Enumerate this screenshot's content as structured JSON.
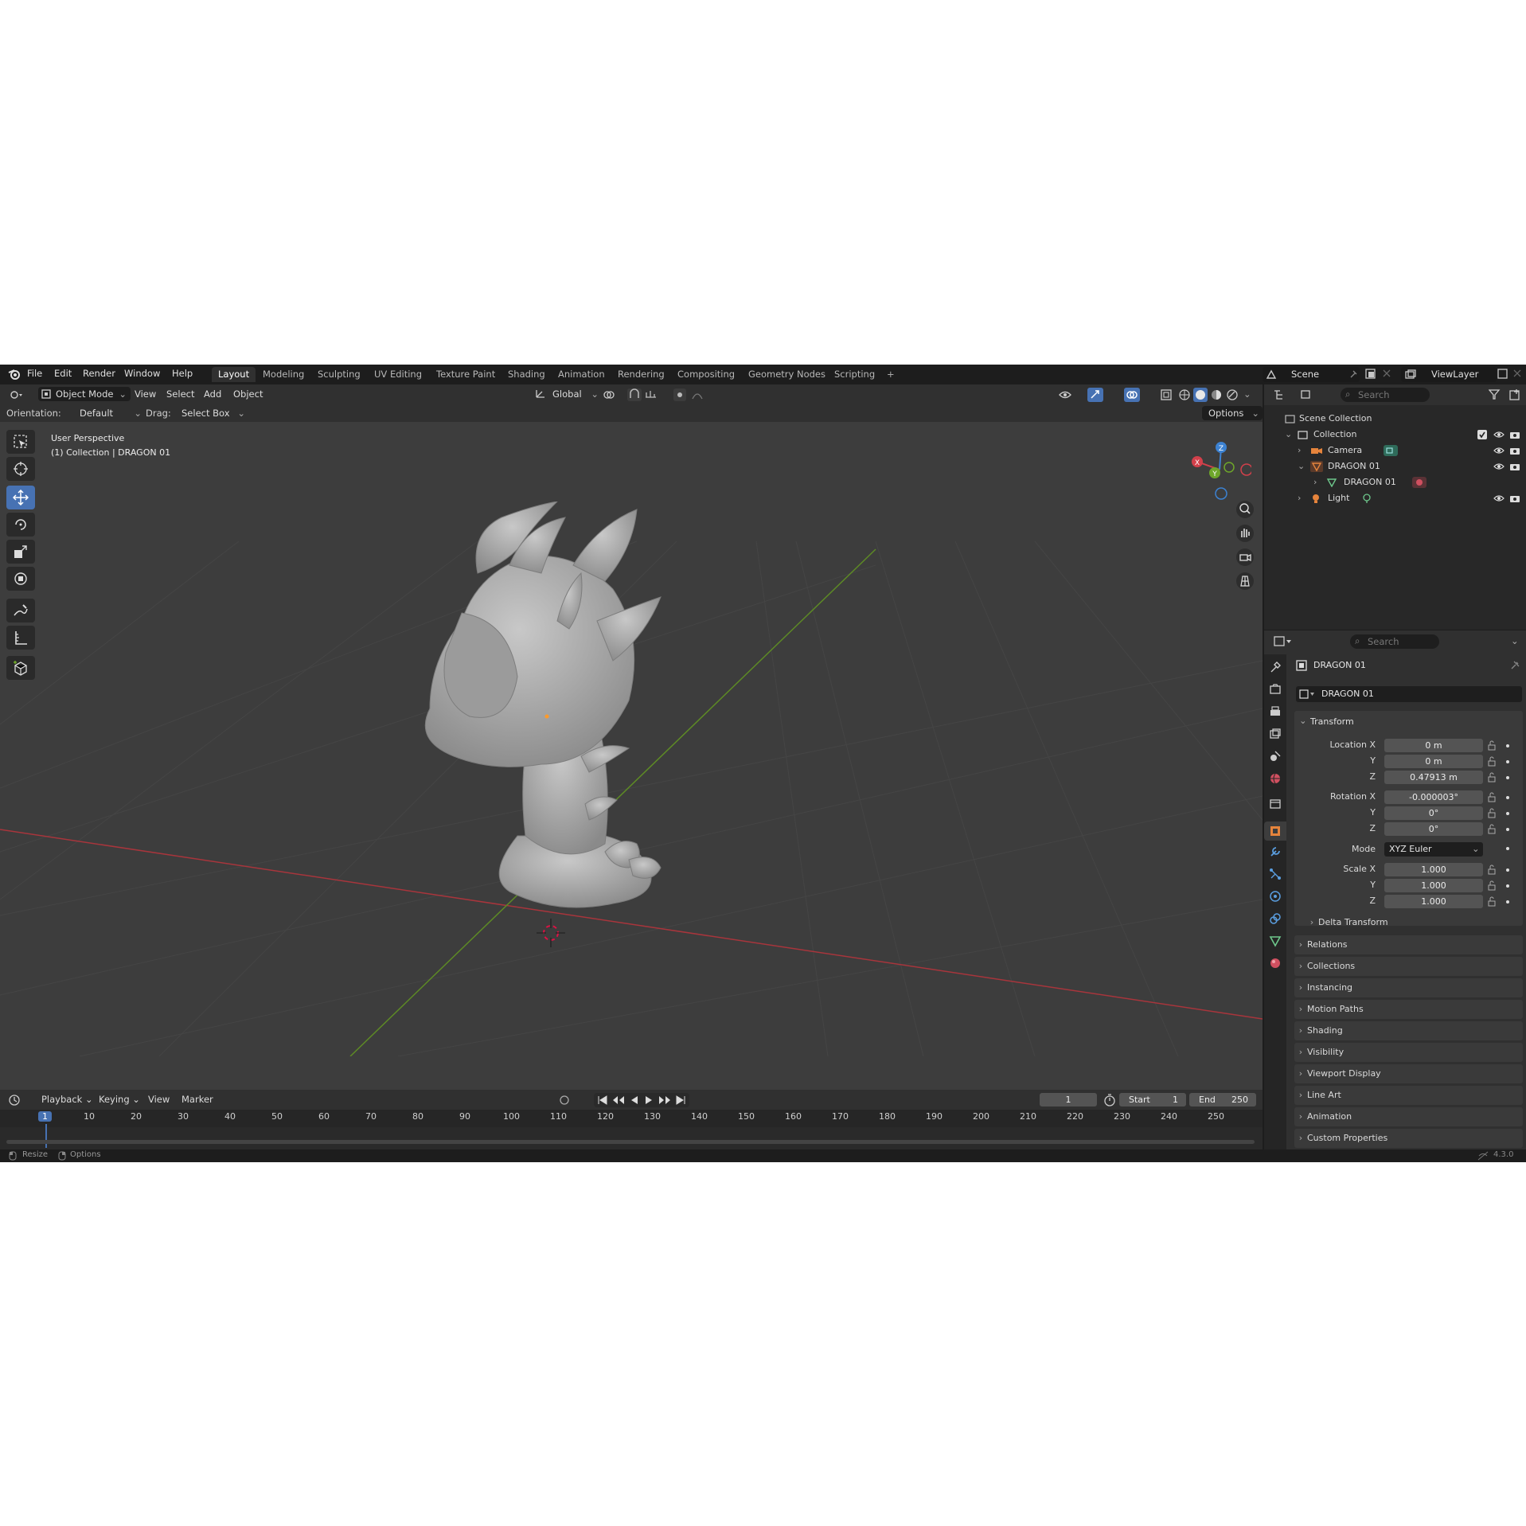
{
  "menu": [
    "File",
    "Edit",
    "Render",
    "Window",
    "Help"
  ],
  "workspaces": [
    "Layout",
    "Modeling",
    "Sculpting",
    "UV Editing",
    "Texture Paint",
    "Shading",
    "Animation",
    "Rendering",
    "Compositing",
    "Geometry Nodes",
    "Scripting"
  ],
  "scene": {
    "name": "Scene",
    "view_layer": "ViewLayer"
  },
  "viewport_header": {
    "mode": "Object Mode",
    "view": "View",
    "select": "Select",
    "add": "Add",
    "object": "Object",
    "transform_space": "Global"
  },
  "tool_settings": {
    "orientation_label": "Orientation:",
    "orientation": "Default",
    "drag_label": "Drag:",
    "drag": "Select Box",
    "options": "Options"
  },
  "overlay_text": {
    "perspective": "User Perspective",
    "collection": "(1) Collection | DRAGON 01"
  },
  "gizmo": {
    "x": "X",
    "y": "Y",
    "z": "Z"
  },
  "outliner": {
    "search_placeholder": "Search",
    "scene_collection": "Scene Collection",
    "collection": "Collection",
    "items": [
      "Camera",
      "DRAGON 01",
      "DRAGON 01",
      "Light"
    ]
  },
  "properties": {
    "search_placeholder": "Search",
    "object_name": "DRAGON 01",
    "data_name": "DRAGON 01",
    "transform_title": "Transform",
    "location_label": "Location X",
    "location": [
      "0 m",
      "0 m",
      "0.47913 m"
    ],
    "rotation_label": "Rotation X",
    "rotation": [
      "-0.000003°",
      "0°",
      "0°"
    ],
    "mode_label": "Mode",
    "mode": "XYZ Euler",
    "scale_label": "Scale X",
    "scale": [
      "1.000",
      "1.000",
      "1.000"
    ],
    "y_label": "Y",
    "z_label": "Z",
    "delta": "Delta Transform",
    "panels": [
      "Relations",
      "Collections",
      "Instancing",
      "Motion Paths",
      "Shading",
      "Visibility",
      "Viewport Display",
      "Line Art",
      "Animation",
      "Custom Properties"
    ]
  },
  "timeline": {
    "playback": "Playback",
    "keying": "Keying",
    "view": "View",
    "marker": "Marker",
    "current_frame": "1",
    "start_label": "Start",
    "start": "1",
    "end_label": "End",
    "end": "250",
    "ruler": [
      "1",
      "10",
      "20",
      "30",
      "40",
      "50",
      "60",
      "70",
      "80",
      "90",
      "100",
      "110",
      "120",
      "130",
      "140",
      "150",
      "160",
      "170",
      "180",
      "190",
      "200",
      "210",
      "220",
      "230",
      "240",
      "250"
    ]
  },
  "status": {
    "resize": "Resize",
    "options": "Options",
    "version": "4.3.0"
  },
  "colors": {
    "accent": "#4772b3",
    "x_axis": "#d2404b",
    "y_axis": "#6ea62a",
    "z_axis": "#3c82d2"
  }
}
